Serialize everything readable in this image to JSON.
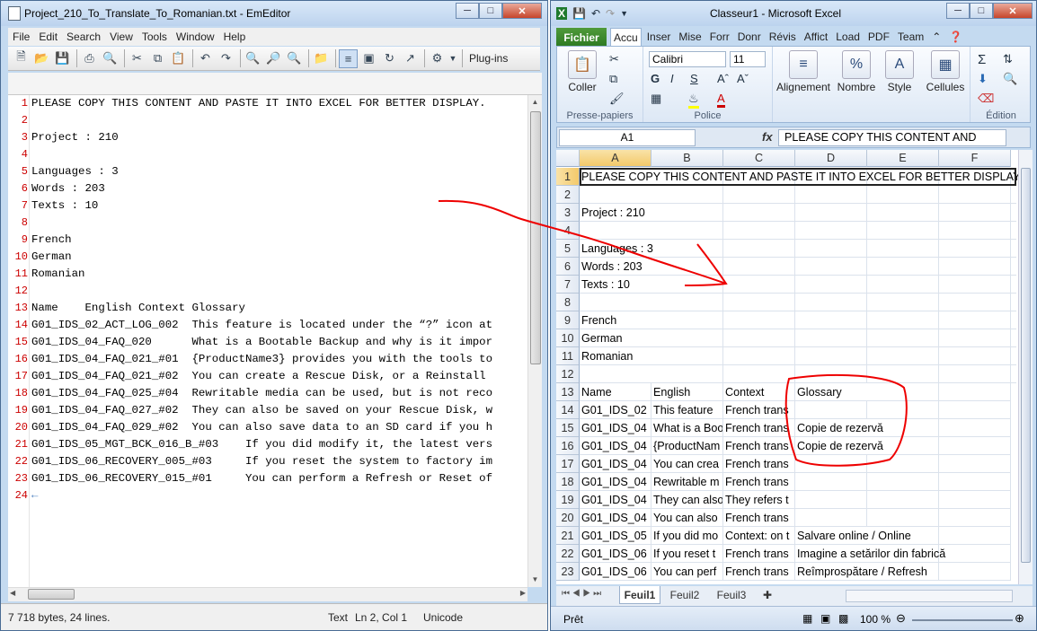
{
  "emeditor": {
    "title": "Project_210_To_Translate_To_Romanian.txt - EmEditor",
    "menu": [
      "File",
      "Edit",
      "Search",
      "View",
      "Tools",
      "Window",
      "Help"
    ],
    "plugins_label": "Plug-ins",
    "line_numbers": [
      "1",
      "2",
      "3",
      "4",
      "5",
      "6",
      "7",
      "8",
      "9",
      "10",
      "11",
      "12",
      "13",
      "14",
      "15",
      "16",
      "17",
      "18",
      "19",
      "20",
      "21",
      "22",
      "23",
      "24"
    ],
    "lines": [
      "PLEASE COPY THIS CONTENT AND PASTE IT INTO EXCEL FOR BETTER DISPLAY.",
      "",
      "Project : 210",
      "",
      "Languages : 3",
      "Words : 203",
      "Texts : 10",
      "",
      "French",
      "German",
      "Romanian",
      "",
      "Name    English Context Glossary",
      "G01_IDS_02_ACT_LOG_002  This feature is located under the “?” icon at",
      "G01_IDS_04_FAQ_020      What is a Bootable Backup and why is it impor",
      "G01_IDS_04_FAQ_021_#01  {ProductName3} provides you with the tools to",
      "G01_IDS_04_FAQ_021_#02  You can create a Rescue Disk, or a Reinstall",
      "G01_IDS_04_FAQ_025_#04  Rewritable media can be used, but is not reco",
      "G01_IDS_04_FAQ_027_#02  They can also be saved on your Rescue Disk, w",
      "G01_IDS_04_FAQ_029_#02  You can also save data to an SD card if you h",
      "G01_IDS_05_MGT_BCK_016_B_#03    If you did modify it, the latest vers",
      "G01_IDS_06_RECOVERY_005_#03     If you reset the system to factory im",
      "G01_IDS_06_RECOVERY_015_#01     You can perform a Refresh or Reset of",
      "←"
    ],
    "status": {
      "size": "7 718 bytes, 24 lines.",
      "mode": "Text",
      "pos": "Ln 2, Col 1",
      "encoding": "Unicode"
    }
  },
  "excel": {
    "title": "Classeur1 - Microsoft Excel",
    "file_tab": "Fichier",
    "tabs": [
      "Accu",
      "Inser",
      "Mise",
      "Forr",
      "Donr",
      "Révis",
      "Affict",
      "Load",
      "PDF",
      "Team"
    ],
    "groups": {
      "clipboard": "Presse-papiers",
      "font": "Police",
      "edition": "Édition"
    },
    "buttons": {
      "paste": "Coller",
      "alignment": "Alignement",
      "number": "Nombre",
      "style": "Style",
      "cells": "Cellules"
    },
    "font_name": "Calibri",
    "font_size": "11",
    "name_box": "A1",
    "formula": "PLEASE COPY THIS CONTENT AND",
    "columns": [
      "A",
      "B",
      "C",
      "D",
      "E",
      "F"
    ],
    "row_numbers": [
      "1",
      "2",
      "3",
      "4",
      "5",
      "6",
      "7",
      "8",
      "9",
      "10",
      "11",
      "12",
      "13",
      "14",
      "15",
      "16",
      "17",
      "18",
      "19",
      "20",
      "21",
      "22",
      "23"
    ],
    "rows": [
      [
        "PLEASE COPY THIS CONTENT AND PASTE IT INTO EXCEL FOR BETTER DISPLAY.",
        "",
        "",
        ""
      ],
      [
        "",
        "",
        "",
        ""
      ],
      [
        "Project : 210",
        "",
        "",
        ""
      ],
      [
        "",
        "",
        "",
        ""
      ],
      [
        "Languages : 3",
        "",
        "",
        ""
      ],
      [
        "Words : 203",
        "",
        "",
        ""
      ],
      [
        "Texts : 10",
        "",
        "",
        ""
      ],
      [
        "",
        "",
        "",
        ""
      ],
      [
        "French",
        "",
        "",
        ""
      ],
      [
        "German",
        "",
        "",
        ""
      ],
      [
        "Romanian",
        "",
        "",
        ""
      ],
      [
        "",
        "",
        "",
        ""
      ],
      [
        "Name",
        "English",
        "Context",
        "Glossary"
      ],
      [
        "G01_IDS_02",
        "This feature",
        "French trans",
        ""
      ],
      [
        "G01_IDS_04",
        "What is a Boo",
        "French trans",
        "Copie de rezervă"
      ],
      [
        "G01_IDS_04",
        "{ProductNam",
        "French trans",
        "Copie de rezervă"
      ],
      [
        "G01_IDS_04",
        "You can crea",
        "French trans",
        ""
      ],
      [
        "G01_IDS_04",
        "Rewritable m",
        "French trans",
        ""
      ],
      [
        "G01_IDS_04",
        "They can also",
        "They refers t",
        ""
      ],
      [
        "G01_IDS_04",
        "You can also",
        "French trans",
        ""
      ],
      [
        "G01_IDS_05",
        "If you did mo",
        "Context: on t",
        "Salvare online / Online"
      ],
      [
        "G01_IDS_06",
        "If you reset t",
        "French trans",
        "Imagine a setărilor din fabrică"
      ],
      [
        "G01_IDS_06",
        "You can perf",
        "French trans",
        "Reîmprospătare / Refresh"
      ]
    ],
    "sheets": [
      "Feuil1",
      "Feuil2",
      "Feuil3"
    ],
    "status": {
      "ready": "Prêt",
      "zoom": "100 %"
    }
  }
}
